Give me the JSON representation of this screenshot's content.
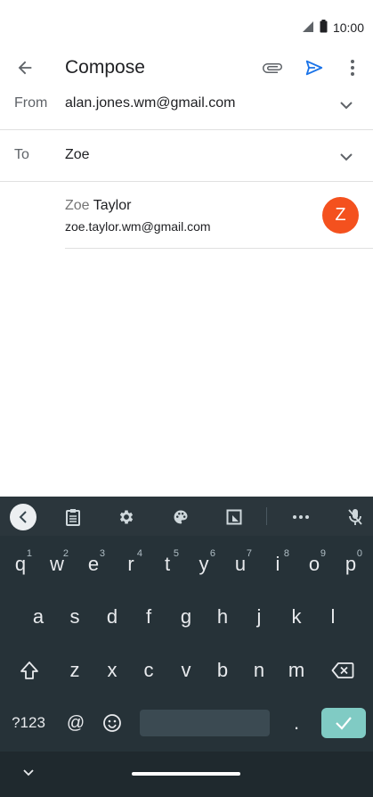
{
  "status_bar": {
    "time": "10:00"
  },
  "app_bar": {
    "title": "Compose"
  },
  "from": {
    "label": "From",
    "value": "alan.jones.wm@gmail.com"
  },
  "to": {
    "label": "To",
    "value": "Zoe"
  },
  "suggestion": {
    "name_match": "Zoe",
    "name_rest": " Taylor",
    "email": "zoe.taylor.wm@gmail.com",
    "avatar_letter": "Z",
    "avatar_color": "#f4511e"
  },
  "colors": {
    "accent": "#1a73e8",
    "keyboard_bg": "#263238",
    "enter_key": "#80cbc4"
  },
  "keyboard": {
    "row1": [
      {
        "k": "q",
        "h": "1"
      },
      {
        "k": "w",
        "h": "2"
      },
      {
        "k": "e",
        "h": "3"
      },
      {
        "k": "r",
        "h": "4"
      },
      {
        "k": "t",
        "h": "5"
      },
      {
        "k": "y",
        "h": "6"
      },
      {
        "k": "u",
        "h": "7"
      },
      {
        "k": "i",
        "h": "8"
      },
      {
        "k": "o",
        "h": "9"
      },
      {
        "k": "p",
        "h": "0"
      }
    ],
    "row2": [
      "a",
      "s",
      "d",
      "f",
      "g",
      "h",
      "j",
      "k",
      "l"
    ],
    "row3": [
      "z",
      "x",
      "c",
      "v",
      "b",
      "n",
      "m"
    ],
    "symbols_label": "?123",
    "at_label": "@",
    "period_label": "."
  }
}
